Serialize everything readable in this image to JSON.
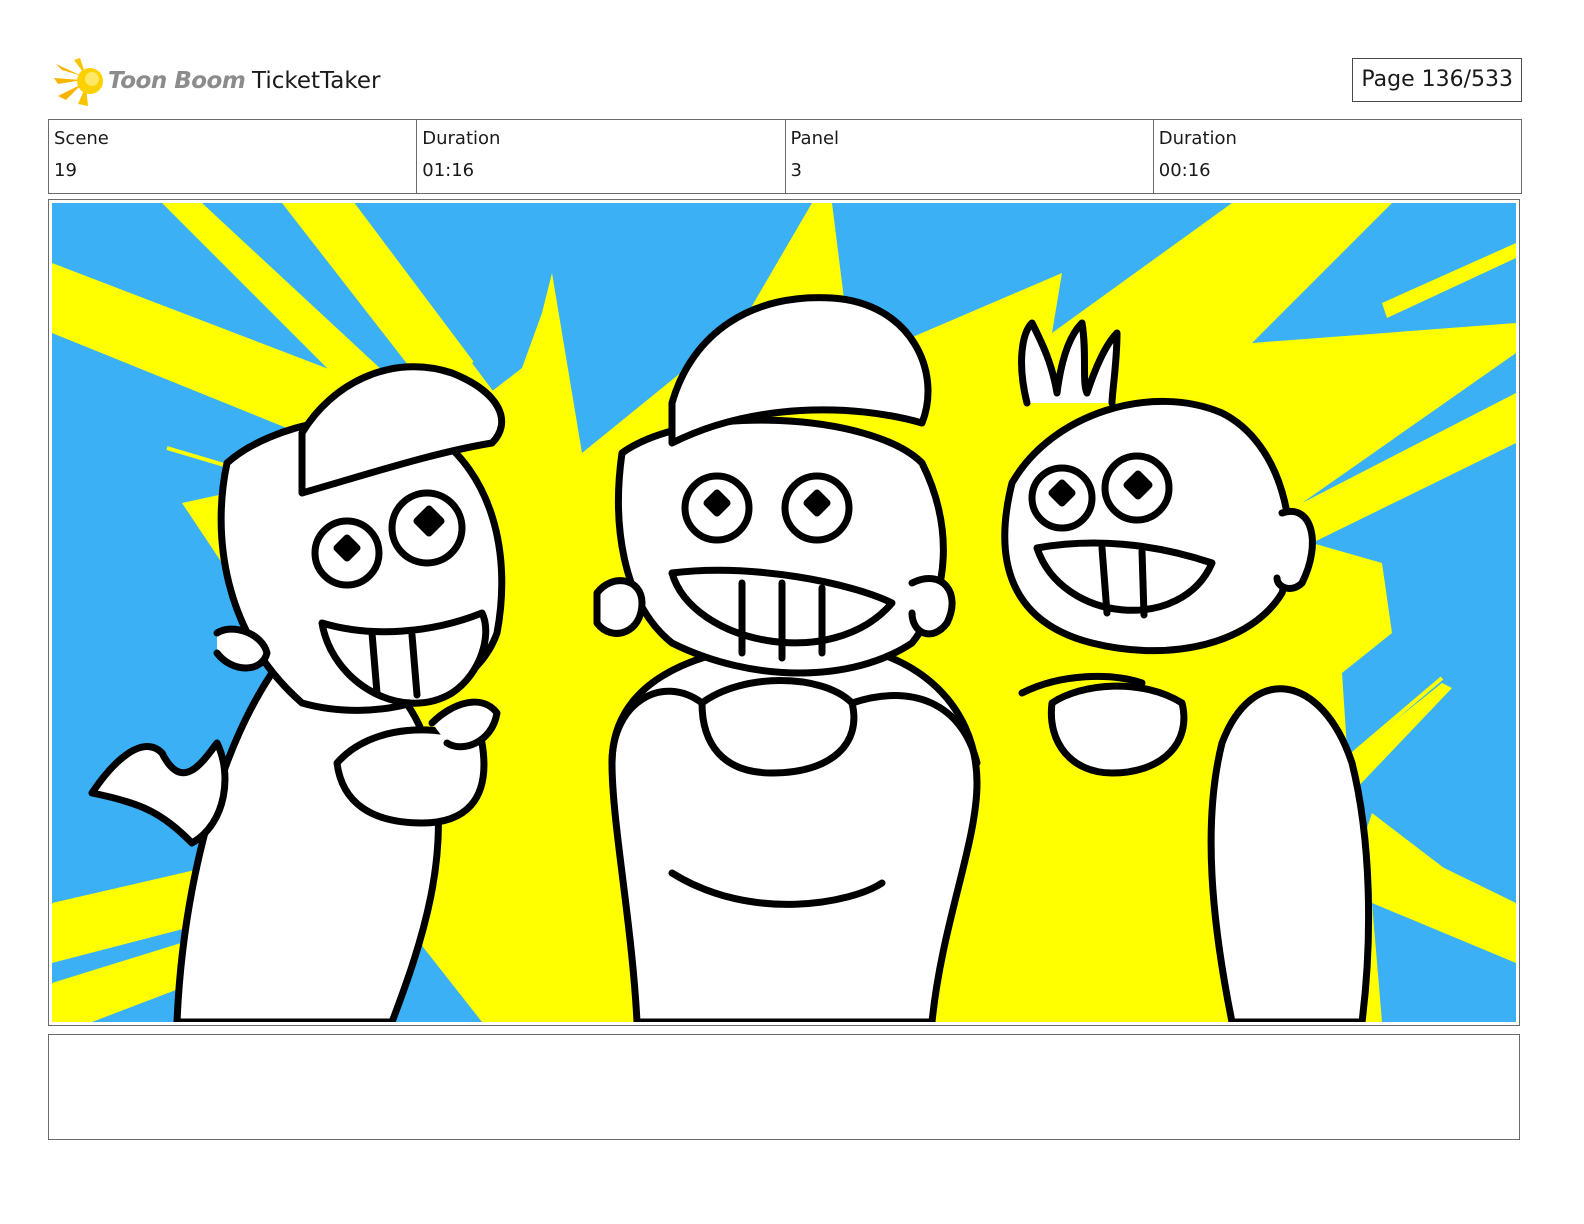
{
  "header": {
    "logo_text": "Toon Boom",
    "logo_icon": "starburst-logo-icon",
    "project_title": "TicketTaker",
    "page_label": "Page 136/533"
  },
  "info": {
    "scene_label": "Scene",
    "scene_value": "19",
    "scene_duration_label": "Duration",
    "scene_duration_value": "01:16",
    "panel_label": "Panel",
    "panel_value": "3",
    "panel_duration_label": "Duration",
    "panel_duration_value": "00:16"
  },
  "panel": {
    "image": "storyboard-sketch",
    "background_color": "#3bb0f5",
    "burst_color": "#ffff00",
    "line_color": "#000000"
  },
  "notes": {
    "text": ""
  }
}
